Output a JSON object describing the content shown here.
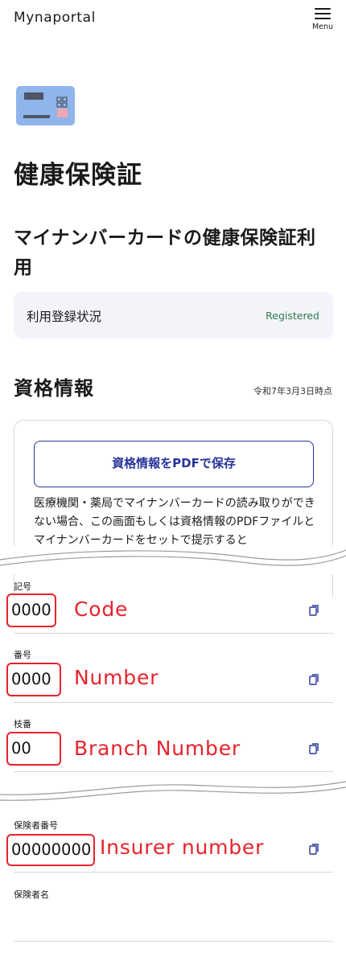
{
  "header": {
    "brand": "Mynaportal",
    "menu_label": "Menu"
  },
  "page": {
    "title": "健康保険証",
    "subtitle": "マイナンバーカードの健康保険証利用"
  },
  "registration": {
    "label": "利用登録状況",
    "status": "Registered",
    "status_color": "#2e7b4a"
  },
  "qualification": {
    "title": "資格情報",
    "as_of": "令和7年3月3日時点",
    "pdf_button": "資格情報をPDFで保存",
    "description": "医療機関・薬局でマイナンバーカードの読み取りができない場合、この画面もしくは資格情報のPDFファイルとマイナンバーカードをセットで提示すると"
  },
  "fields": {
    "code": {
      "label": "記号",
      "value": "0000",
      "annotation": "Code",
      "copy_icon": "copy-icon"
    },
    "number": {
      "label": "番号",
      "value": "0000",
      "annotation": "Number",
      "copy_icon": "copy-icon"
    },
    "branch": {
      "label": "枝番",
      "value": "00",
      "annotation": "Branch Number",
      "copy_icon": "copy-icon"
    },
    "insurer_number": {
      "label": "保険者番号",
      "value": "00000000",
      "annotation": "Insurer number",
      "copy_icon": "copy-icon"
    },
    "insurer_name": {
      "label": "保険者名",
      "value": ""
    }
  },
  "colors": {
    "accent": "#27349a",
    "annotation": "#e8232c",
    "status_bg": "#f3f4fa"
  }
}
